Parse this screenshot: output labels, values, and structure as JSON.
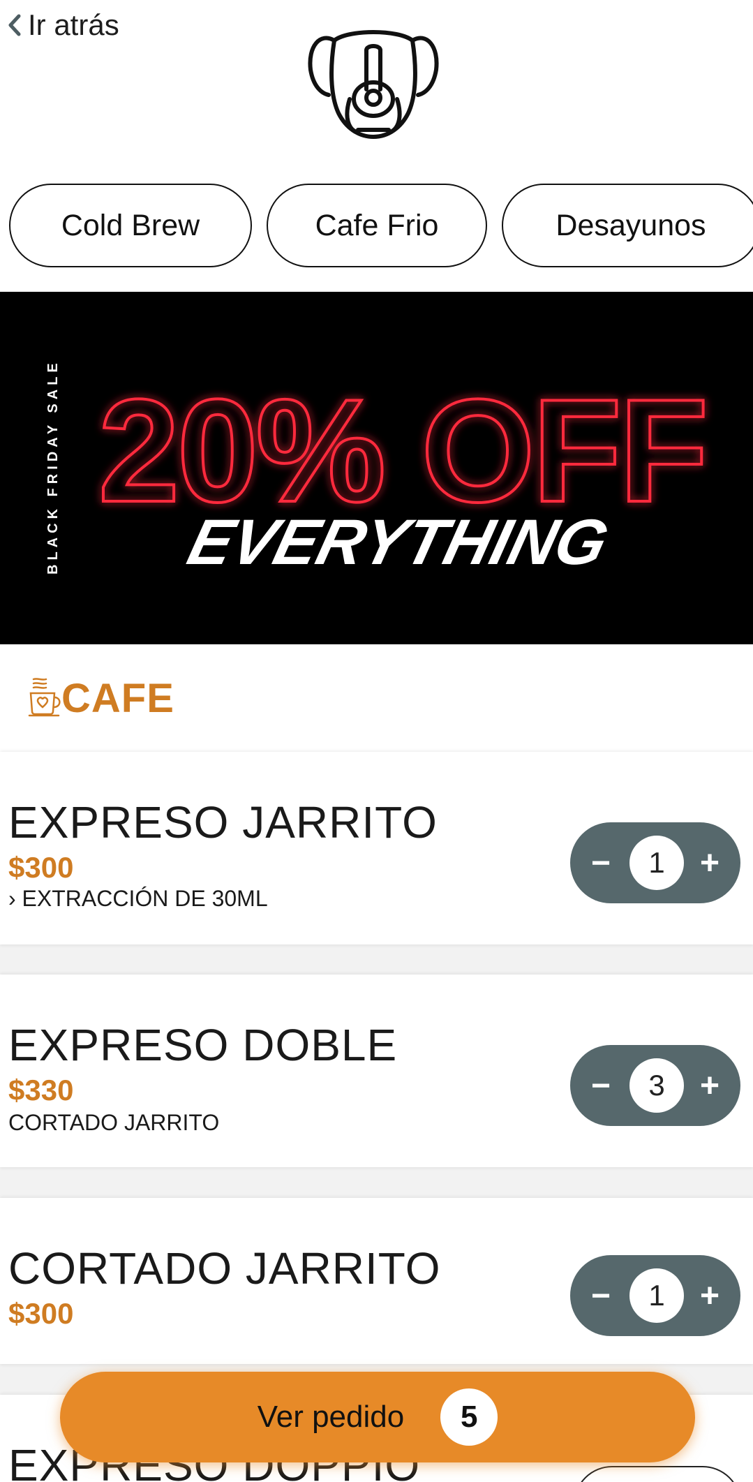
{
  "header": {
    "back_label": "Ir atrás"
  },
  "categories": [
    "Cold Brew",
    "Cafe Frio",
    "Desayunos"
  ],
  "banner": {
    "side_text": "BLACK FRIDAY SALE",
    "headline": "20% OFF",
    "script_text": "EVERYTHING"
  },
  "section": {
    "title": "CAFE"
  },
  "products": [
    {
      "name": "EXPRESO JARRITO",
      "price": "$300",
      "description": "› EXTRACCIÓN DE 30ML",
      "qty": "1"
    },
    {
      "name": "EXPRESO DOBLE",
      "price": "$330",
      "description": "CORTADO JARRITO",
      "qty": "3"
    },
    {
      "name": "CORTADO JARRITO",
      "price": "$300",
      "description": "",
      "qty": "1"
    },
    {
      "name": "EXPRESO DOPPIO",
      "price": "",
      "description": "",
      "qty": ""
    }
  ],
  "stepper": {
    "minus": "−",
    "plus": "+"
  },
  "order": {
    "label": "Ver pedido",
    "count": "5"
  },
  "colors": {
    "accent": "#cf7c22",
    "order_button": "#e78a28",
    "stepper": "#56686c"
  }
}
